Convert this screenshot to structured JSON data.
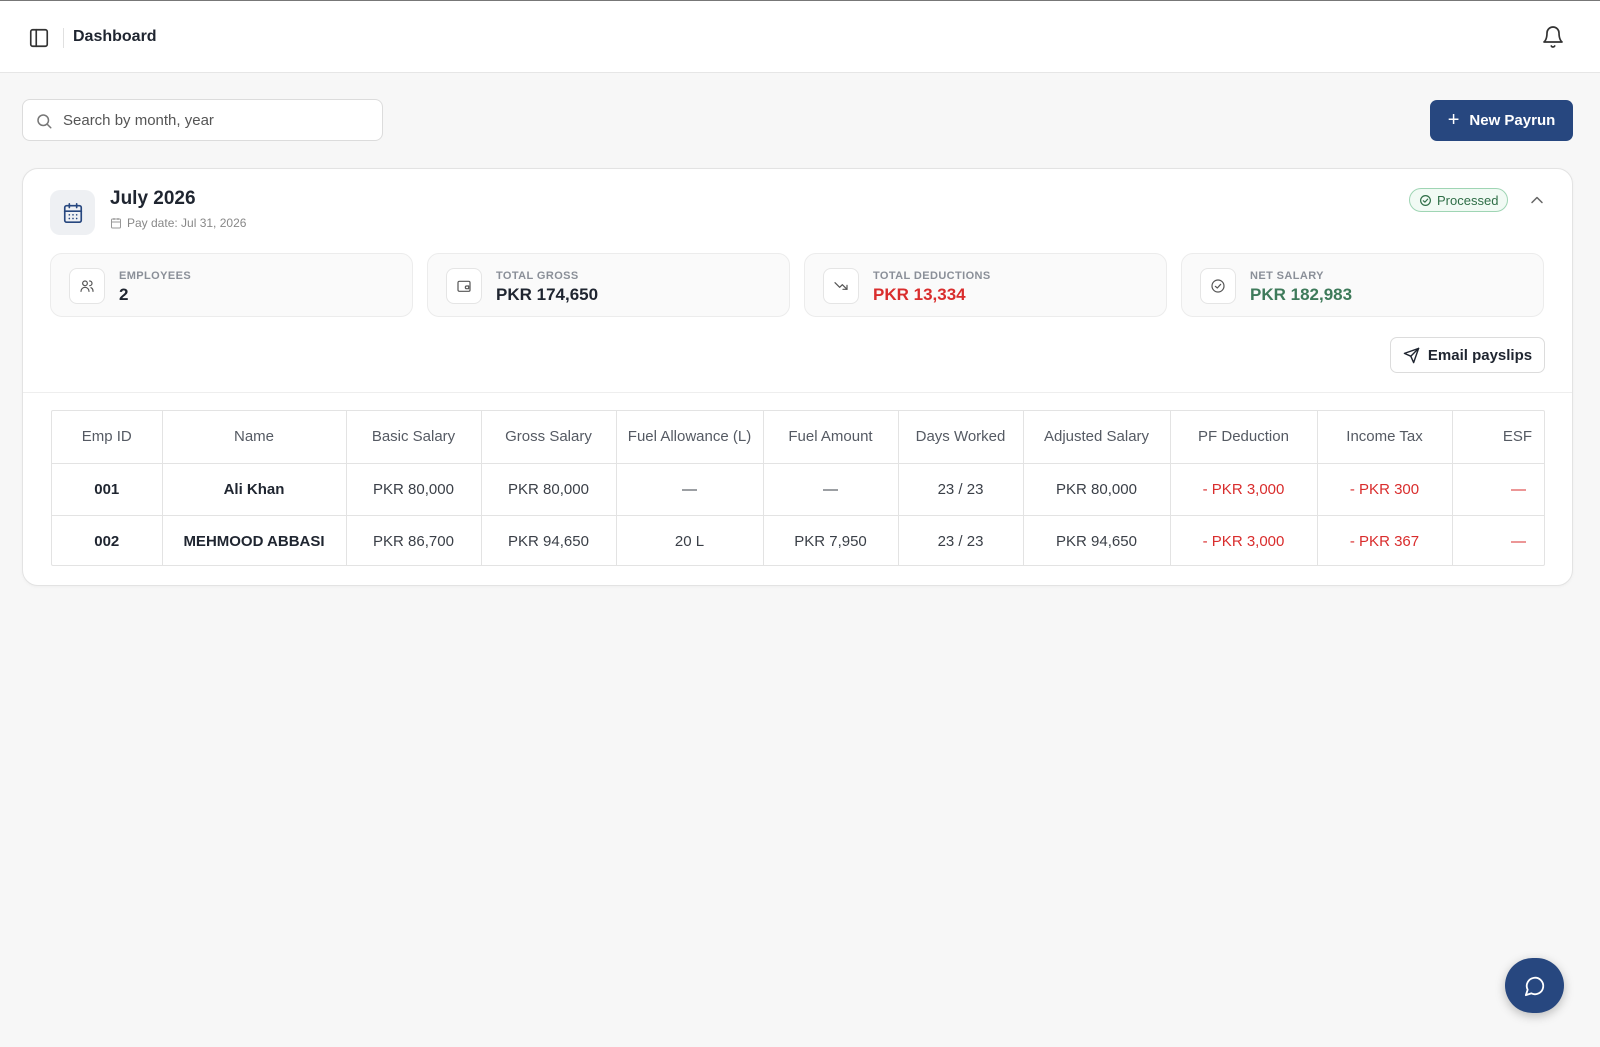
{
  "header": {
    "title": "Dashboard"
  },
  "search": {
    "placeholder": "Search by month, year",
    "value": ""
  },
  "actions": {
    "new_payrun_label": "New Payrun",
    "email_payslips_label": "Email payslips"
  },
  "payrun": {
    "period": "July 2026",
    "pay_date": "Pay date: Jul 31, 2026",
    "status": "Processed",
    "status_color": "#2f6e47",
    "stats": [
      {
        "label": "EMPLOYEES",
        "value": "2",
        "icon": "users-icon"
      },
      {
        "label": "TOTAL GROSS",
        "value": "PKR 174,650",
        "icon": "wallet-icon"
      },
      {
        "label": "TOTAL DEDUCTIONS",
        "value": "PKR 13,334",
        "icon": "trending-down-icon",
        "color": "#d92d2d"
      },
      {
        "label": "NET SALARY",
        "value": "PKR 182,983",
        "icon": "check-circle-icon",
        "color": "#3e7a5a"
      }
    ]
  },
  "table": {
    "columns": [
      "Emp ID",
      "Name",
      "Basic Salary",
      "Gross Salary",
      "Fuel Allowance (L)",
      "Fuel Amount",
      "Days Worked",
      "Adjusted Salary",
      "PF Deduction",
      "Income Tax",
      "ESF"
    ],
    "rows": [
      [
        "001",
        "Ali Khan",
        "PKR 80,000",
        "PKR 80,000",
        "—",
        "—",
        "23 / 23",
        "PKR 80,000",
        "- PKR 3,000",
        "- PKR 300",
        "—"
      ],
      [
        "002",
        "MEHMOOD ABBASI",
        "PKR 86,700",
        "PKR 94,650",
        "20 L",
        "PKR 7,950",
        "23 / 23",
        "PKR 94,650",
        "- PKR 3,000",
        "- PKR 367",
        "—"
      ]
    ]
  },
  "theme": {
    "primary": "#27477f",
    "negative": "#d92d2d",
    "positive": "#3e7a5a"
  }
}
